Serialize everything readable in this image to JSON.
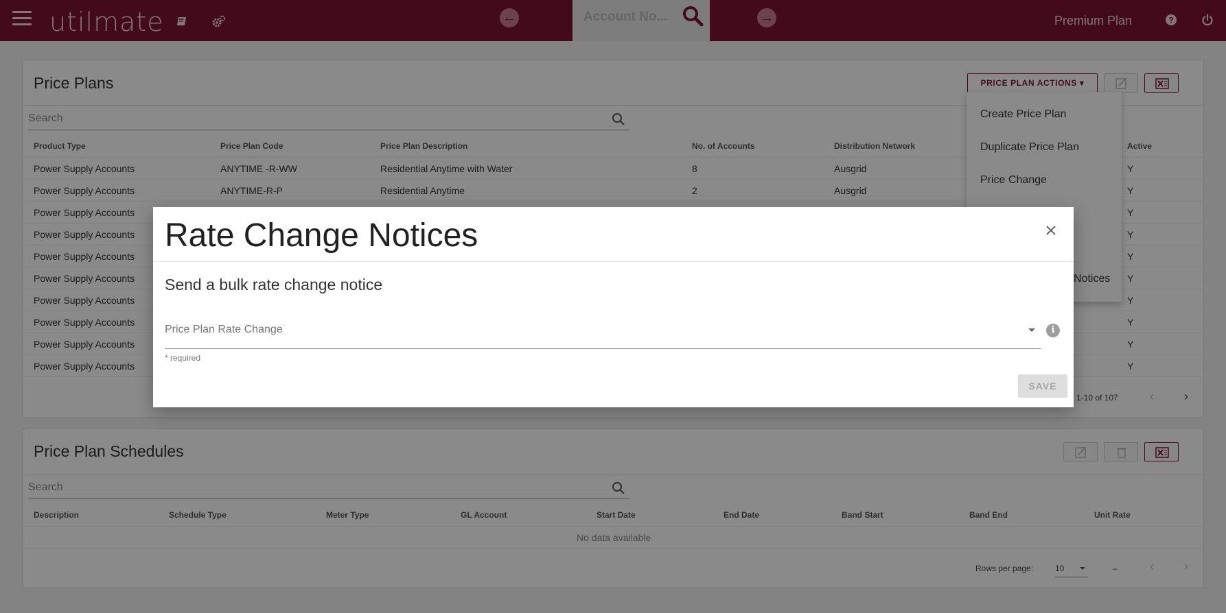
{
  "topbar": {
    "logo": "utilmate",
    "account_placeholder": "Account No...",
    "plan_name": "Premium Plan"
  },
  "price_plans": {
    "title": "Price Plans",
    "actions_label": "PRICE PLAN ACTIONS",
    "search_placeholder": "Search",
    "columns": [
      "Product Type",
      "Price Plan Code",
      "Price Plan Description",
      "No. of Accounts",
      "Distribution Network",
      "Active"
    ],
    "rows": [
      {
        "product": "Power Supply Accounts",
        "code": "ANYTIME -R-WW",
        "desc": "Residential Anytime with Water",
        "accounts": "8",
        "network": "Ausgrid",
        "active": "Y"
      },
      {
        "product": "Power Supply Accounts",
        "code": "ANYTIME-R-P",
        "desc": "Residential Anytime",
        "accounts": "2",
        "network": "Ausgrid",
        "active": "Y"
      },
      {
        "product": "Power Supply Accounts",
        "code": "",
        "desc": "",
        "accounts": "",
        "network": "",
        "active": "Y"
      },
      {
        "product": "Power Supply Accounts",
        "code": "",
        "desc": "",
        "accounts": "",
        "network": "",
        "active": "Y"
      },
      {
        "product": "Power Supply Accounts",
        "code": "",
        "desc": "",
        "accounts": "",
        "network": "",
        "active": "Y"
      },
      {
        "product": "Power Supply Accounts",
        "code": "",
        "desc": "",
        "accounts": "",
        "network": "",
        "active": "Y"
      },
      {
        "product": "Power Supply Accounts",
        "code": "",
        "desc": "",
        "accounts": "",
        "network": "",
        "active": "Y"
      },
      {
        "product": "Power Supply Accounts",
        "code": "",
        "desc": "",
        "accounts": "",
        "network": "",
        "active": "Y"
      },
      {
        "product": "Power Supply Accounts",
        "code": "",
        "desc": "",
        "accounts": "",
        "network": "",
        "active": "Y"
      },
      {
        "product": "Power Supply Accounts",
        "code": "",
        "desc": "",
        "accounts": "",
        "network": "",
        "active": "Y"
      }
    ],
    "pager": "1-10 of 107"
  },
  "actions_menu": {
    "items": [
      "Create Price Plan",
      "Duplicate Price Plan",
      "Price Change",
      "Notices"
    ]
  },
  "schedules": {
    "title": "Price Plan Schedules",
    "search_placeholder": "Search",
    "columns": [
      "Description",
      "Schedule Type",
      "Meter Type",
      "GL Account",
      "Start Date",
      "End Date",
      "Band Start",
      "Band End",
      "Unit Rate"
    ],
    "empty_text": "No data available",
    "rows_per_page_label": "Rows per page:",
    "rows_per_page_value": "10",
    "pager": "–"
  },
  "modal": {
    "title": "Rate Change Notices",
    "subtitle": "Send a bulk rate change notice",
    "select_label": "Price Plan Rate Change",
    "required_text": "* required",
    "save_label": "SAVE"
  },
  "colors": {
    "brand": "#7d1433",
    "overlay": "rgba(0,0,0,0.46)"
  }
}
